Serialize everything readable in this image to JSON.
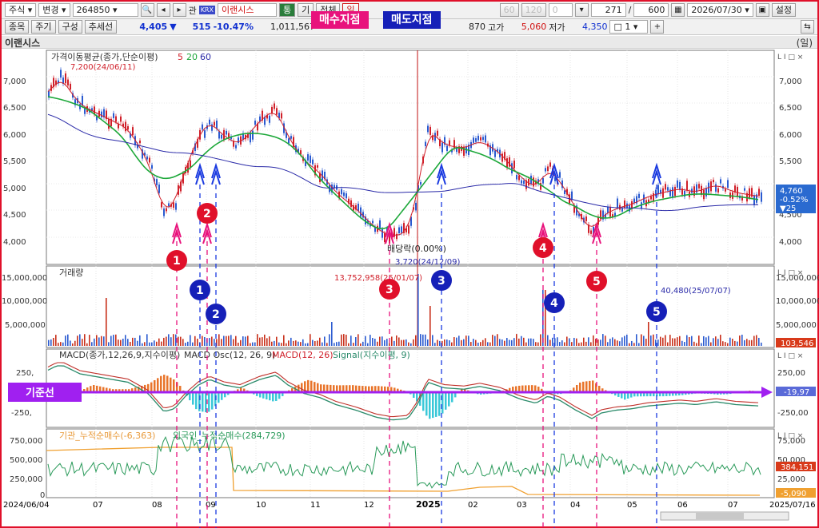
{
  "toolbar1": {
    "market": "주식",
    "mode": "변경",
    "code": "264850",
    "gwan": "관",
    "krx": "KRX",
    "name": "이랜시스",
    "tong": "통",
    "gi": "기",
    "all": "전체",
    "il": "일",
    "ju": "주",
    "disabled_nums": [
      "60",
      "120"
    ],
    "zero": "0",
    "count": "271",
    "total": "600",
    "date": "2026/07/30",
    "settings": "설정"
  },
  "toolbar2": {
    "btn1": "종목",
    "btn2": "주기",
    "btn3": "구성",
    "btn4": "추세선",
    "price": "4,405",
    "arrow": "▼",
    "change": "515",
    "pct": "-10.47%",
    "volume": "1,011,567",
    "volume2": "870",
    "high_label": "고가",
    "high": "5,060",
    "low_label": "저가",
    "low": "4,350",
    "ratio": "1"
  },
  "overlay": {
    "buy_label": "매수지점",
    "sell_label": "매도지점",
    "baseline_label": "기준선",
    "colors": {
      "buy": "#e8127c",
      "sell": "#1620b8",
      "baseline": "#a020f0",
      "frame": "#e0102a"
    }
  },
  "panel_title": {
    "name": "이랜시스",
    "right": "(일)"
  },
  "price_panel": {
    "legend": "가격이동평균(종가,단순이평)",
    "ma5": "5",
    "ma20": "20",
    "ma60": "60",
    "max_label": "7,200(24/06/11)",
    "min_label": "3,720(24/12/09)",
    "dividend_label": "배당락(0.00%)",
    "y_ticks": [
      "7,000",
      "6,500",
      "6,000",
      "5,500",
      "5,000",
      "4,500",
      "4,000"
    ],
    "last_price": "4,760",
    "last_pct": "-0.52%",
    "last_change": "▼25"
  },
  "volume_panel": {
    "legend": "거래량",
    "max_label": "13,752,958(25/01/07)",
    "recent_label": "40,480(25/07/07)",
    "y_ticks": [
      "15,000,000",
      "10,000,000",
      "5,000,000"
    ],
    "last_value": "103,546"
  },
  "macd_panel": {
    "legend_a": "MACD(종가,12,26,9,지수이평)",
    "legend_b": "MACD Osc(12, 26, 9)",
    "legend_c": "MACD(12, 26)",
    "legend_d": "Signal(지수이평, 9)",
    "y_ticks": [
      "250,00",
      "-250,00"
    ],
    "left_ticks": [
      "250,",
      "-250,"
    ],
    "last_value": "-19,97"
  },
  "flow_panel": {
    "legend_inst": "기관_누적순매수(-6,363)",
    "legend_foreign": "외국인_누적순매수(284,729)",
    "y_ticks": [
      "750,000",
      "500,000",
      "250,000",
      "0"
    ],
    "right_ticks": [
      "75,000",
      "50,000",
      "25,000",
      "0"
    ],
    "last_foreign": "384,151",
    "last_inst": "-5,090"
  },
  "xaxis": [
    "2024/06/04",
    "07",
    "08",
    "09",
    "10",
    "11",
    "12",
    "2025",
    "02",
    "03",
    "04",
    "05",
    "06",
    "07",
    "2025/07/16"
  ],
  "buy_points": [
    "1",
    "2",
    "3",
    "4",
    "5"
  ],
  "sell_points": [
    "1",
    "2",
    "3",
    "4",
    "5"
  ],
  "icons": {
    "search": "search-icon",
    "calendar": "calendar-icon",
    "save": "save-icon"
  }
}
